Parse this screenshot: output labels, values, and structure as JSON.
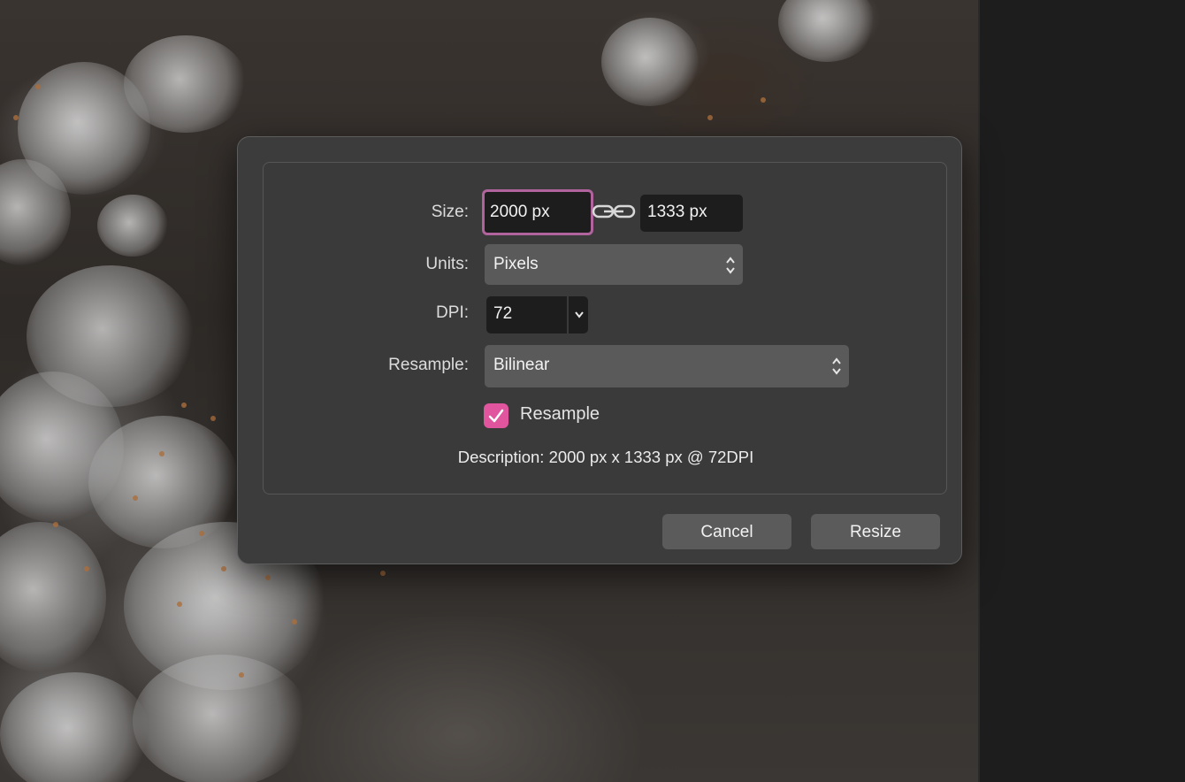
{
  "dialog": {
    "size": {
      "label": "Size:",
      "width_value": "2000 px",
      "height_value": "1333 px"
    },
    "units": {
      "label": "Units:",
      "selected": "Pixels"
    },
    "dpi": {
      "label": "DPI:",
      "value": "72"
    },
    "resample": {
      "label": "Resample:",
      "selected": "Bilinear"
    },
    "resample_checkbox": {
      "label": "Resample",
      "checked": true
    },
    "description": "Description: 2000 px x 1333 px @ 72DPI",
    "buttons": {
      "cancel": "Cancel",
      "resize": "Resize"
    }
  },
  "colors": {
    "accent": "#e0559d",
    "focus_ring": "#b0639c",
    "dialog_bg": "#3c3c3c",
    "field_bg": "#1d1d1d",
    "button_bg": "#5b5b5b"
  }
}
